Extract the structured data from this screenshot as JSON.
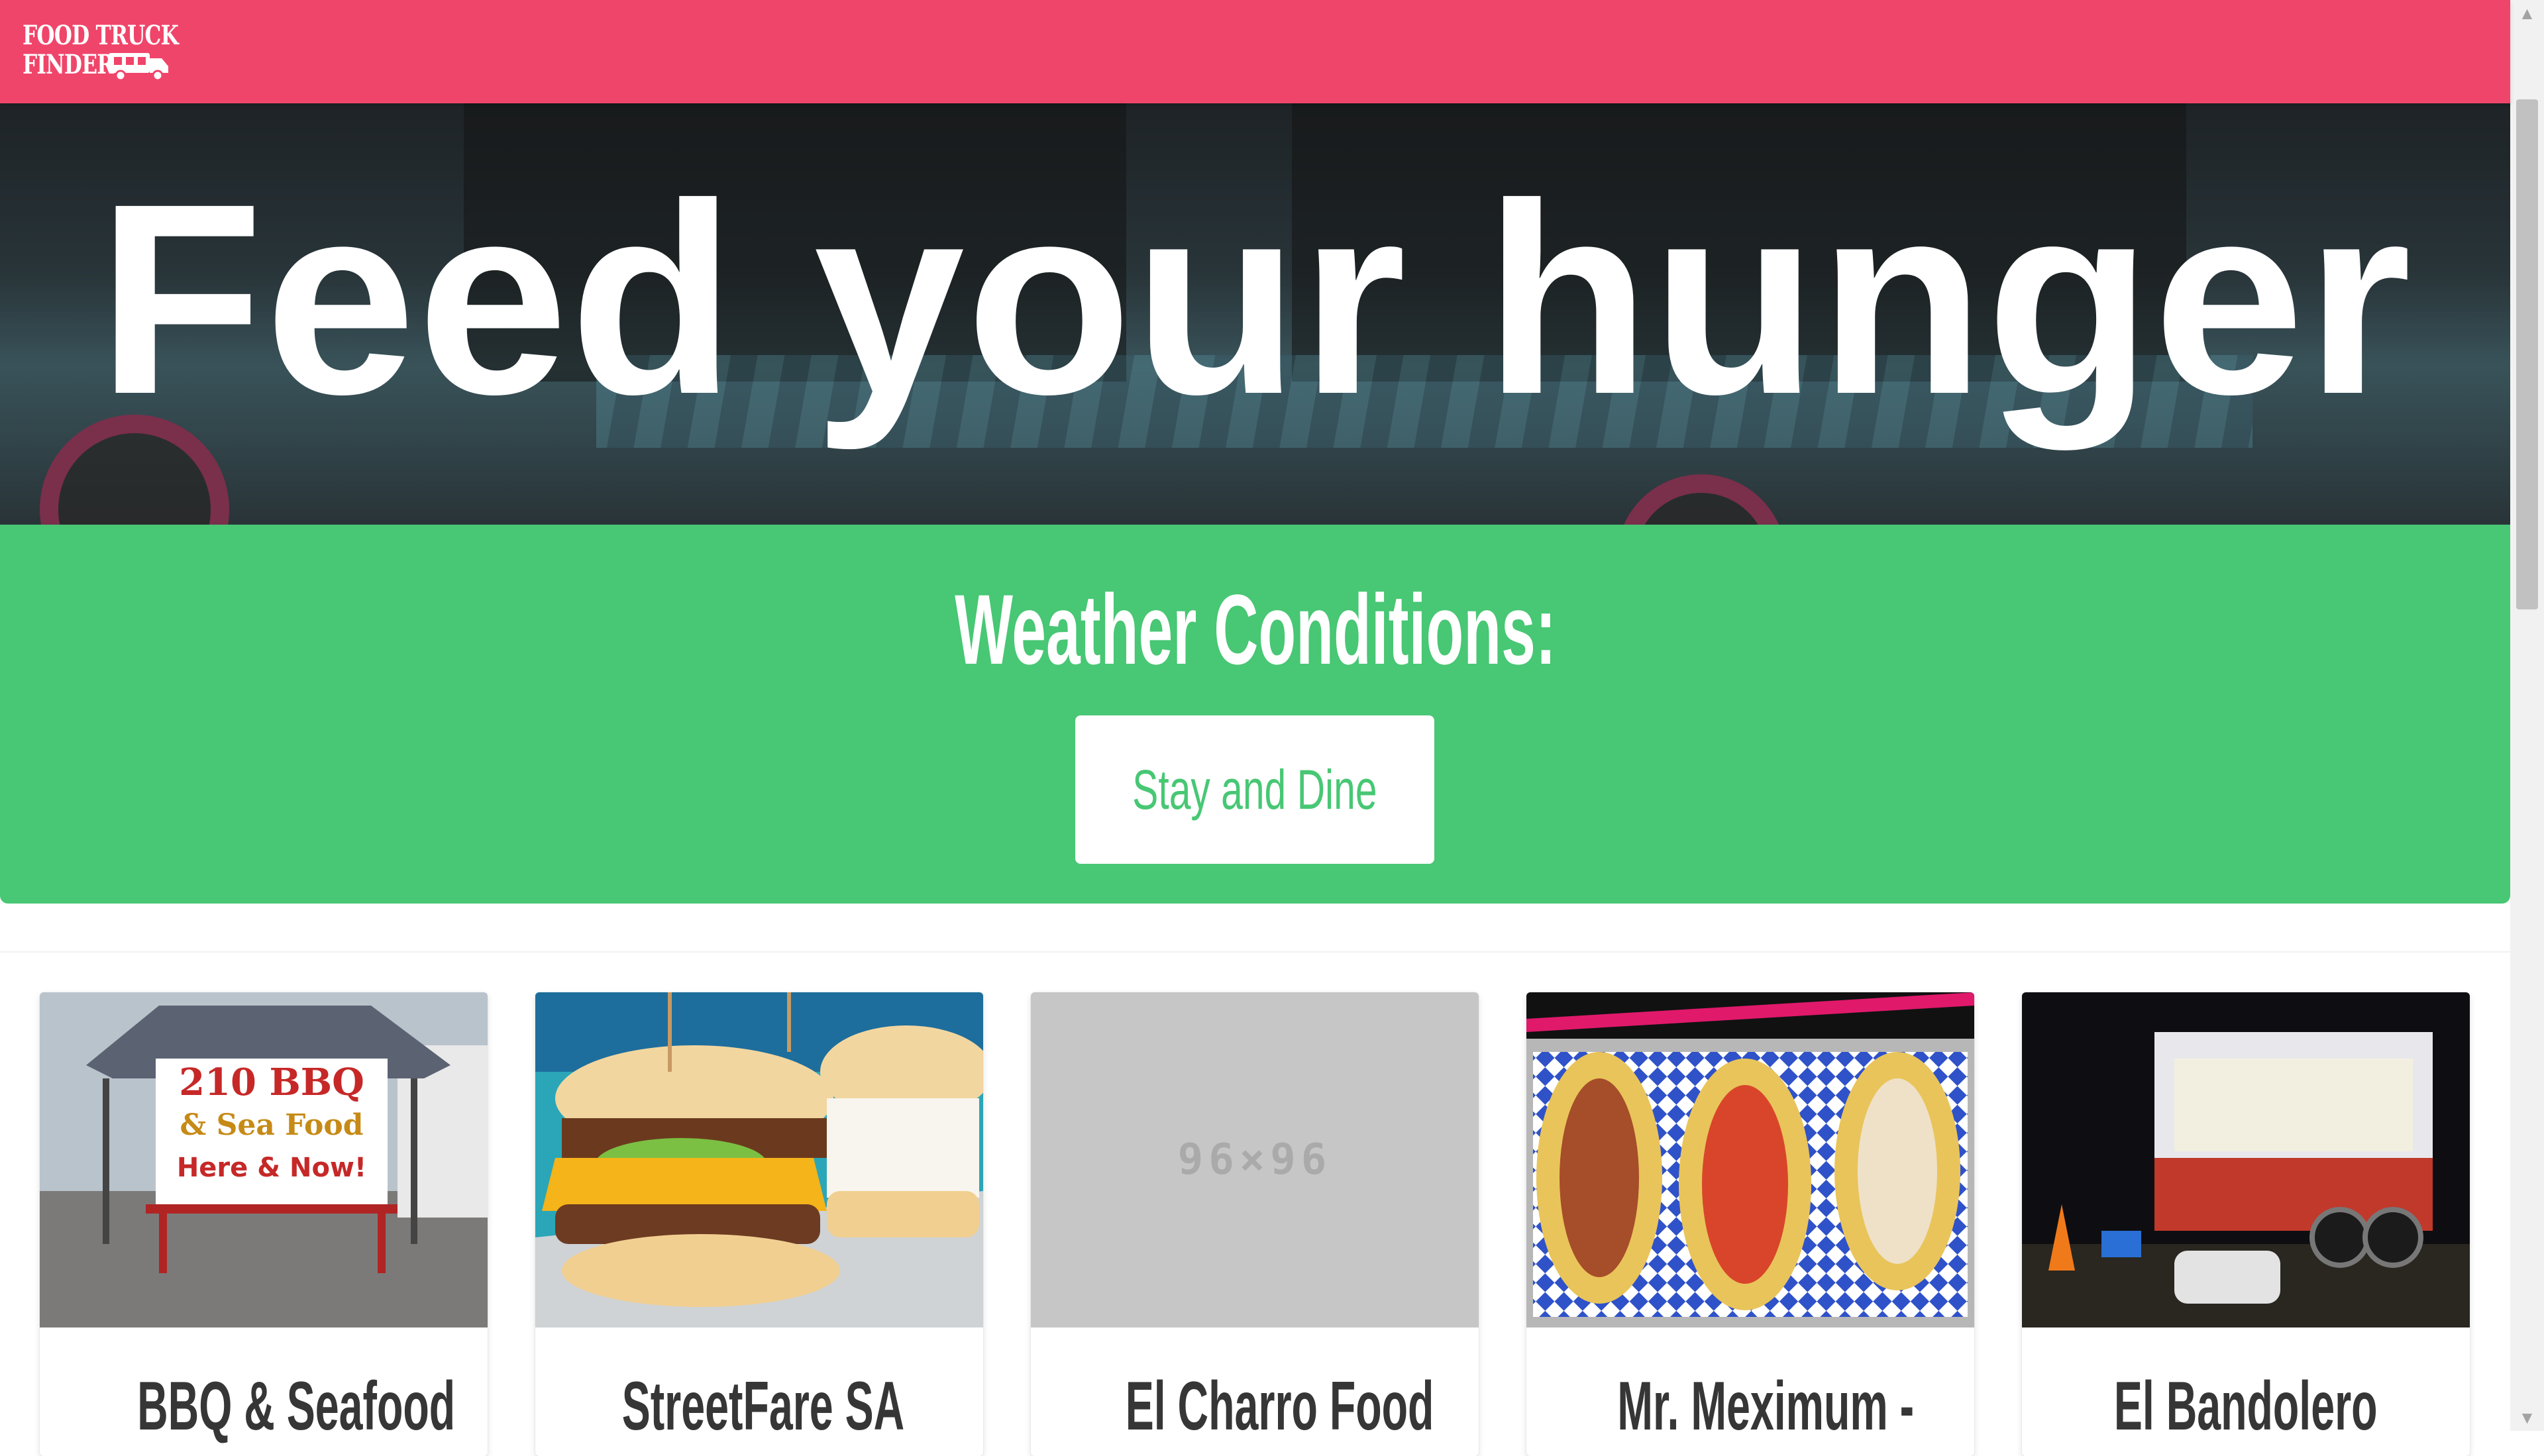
{
  "brand": {
    "line1": "FOOD TRUCK",
    "line2": "FINDER",
    "icon": "food-truck-icon",
    "color": "#f0456a"
  },
  "hero": {
    "title": "Feed your hunger"
  },
  "weather": {
    "title": "Weather Conditions:",
    "button_label": "Stay and Dine",
    "color": "#48c774"
  },
  "trucks": [
    {
      "name": "BBQ & Seafood",
      "image": "bbq-seafood-tent-photo"
    },
    {
      "name": "StreetFare SA",
      "image": "burger-photo"
    },
    {
      "name": "El Charro Food",
      "image": "placeholder-image",
      "placeholder_text": "96×96"
    },
    {
      "name": "Mr. Meximum -",
      "image": "tacos-photo"
    },
    {
      "name": "El Bandolero",
      "image": "food-trailer-night-photo"
    }
  ],
  "bbq_sign": {
    "line1": "210 BBQ",
    "line2": "& Sea Food",
    "line3": "Here & Now!"
  }
}
